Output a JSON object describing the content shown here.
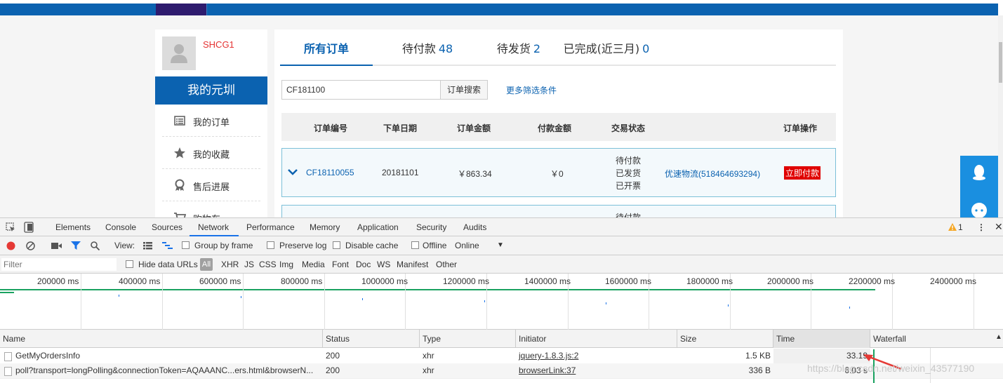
{
  "user": {
    "name": "SHCG1"
  },
  "sidebar": {
    "title": "我的元圳",
    "items": [
      {
        "label": "我的订单",
        "icon": "list-icon"
      },
      {
        "label": "我的收藏",
        "icon": "star-icon"
      },
      {
        "label": "售后进展",
        "icon": "award-icon"
      },
      {
        "label": "购物车",
        "icon": "cart-icon"
      }
    ]
  },
  "tabs": [
    {
      "label": "所有订单",
      "count": ""
    },
    {
      "label": "待付款",
      "count": "48"
    },
    {
      "label": "待发货",
      "count": "2"
    },
    {
      "label": "已完成(近三月)",
      "count": "0"
    }
  ],
  "search": {
    "value": "CF181100",
    "button": "订单搜索",
    "more": "更多筛选条件"
  },
  "table": {
    "headers": [
      "订单编号",
      "下单日期",
      "订单金额",
      "付款金额",
      "交易状态",
      "订单操作"
    ],
    "rows": [
      {
        "order_no": "CF18110055",
        "date": "20181101",
        "amount": "￥863.34",
        "paid": "￥0",
        "status": [
          "待付款",
          "已发货",
          "已开票"
        ],
        "logistics": "优速物流(518464693294)",
        "action": "立即付款"
      },
      {
        "status_partial": "待付款"
      }
    ]
  },
  "devtools": {
    "tabs": [
      "Elements",
      "Console",
      "Sources",
      "Network",
      "Performance",
      "Memory",
      "Application",
      "Security",
      "Audits"
    ],
    "warnings": "1",
    "toolbar": {
      "view": "View:",
      "group_by_frame": "Group by frame",
      "preserve_log": "Preserve log",
      "disable_cache": "Disable cache",
      "offline": "Offline",
      "throttle": "Online"
    },
    "filter": {
      "placeholder": "Filter",
      "hide_data_urls": "Hide data URLs",
      "types": [
        "All",
        "XHR",
        "JS",
        "CSS",
        "Img",
        "Media",
        "Font",
        "Doc",
        "WS",
        "Manifest",
        "Other"
      ]
    },
    "overview_ticks": [
      "200000 ms",
      "400000 ms",
      "600000 ms",
      "800000 ms",
      "1000000 ms",
      "1200000 ms",
      "1400000 ms",
      "1600000 ms",
      "1800000 ms",
      "2000000 ms",
      "2200000 ms",
      "2400000 ms"
    ],
    "columns": [
      "Name",
      "Status",
      "Type",
      "Initiator",
      "Size",
      "Time",
      "Waterfall"
    ],
    "requests": [
      {
        "name": "GetMyOrdersInfo",
        "status": "200",
        "type": "xhr",
        "initiator": "jquery-1.8.3.js:2",
        "size": "1.5 KB",
        "time": "33.19"
      },
      {
        "name": "poll?transport=longPolling&connectionToken=AQAAANC...ers.html&browserN...",
        "status": "200",
        "type": "xhr",
        "initiator": "browserLink:37",
        "size": "336 B",
        "time": "6.03 s"
      }
    ]
  },
  "watermark": "https://blog.csdn.net/weixin_43577190",
  "colors": {
    "brand": "#0b62b0",
    "danger": "#e00000",
    "accent": "#1a73e8"
  }
}
